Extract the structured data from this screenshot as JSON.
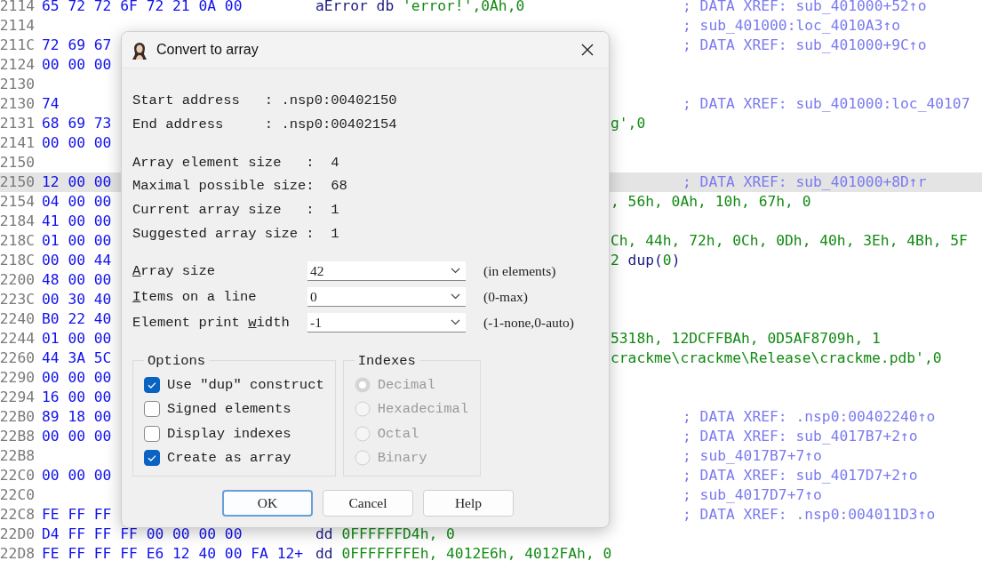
{
  "listing": {
    "rows": [
      {
        "address": "2114",
        "bytes": "65 72 72 6F 72 21 0A 00",
        "code": [
          {
            "text": "aError db ",
            "kind": "name"
          },
          {
            "text": "'error!',0Ah,0",
            "kind": "value"
          }
        ],
        "comment": "; DATA XREF: sub_401000+52↑o",
        "selected": false
      },
      {
        "address": "2114",
        "comment": "; sub_401000:loc_4010A3↑o",
        "selected": false
      },
      {
        "address": "211C",
        "bytes": "72 69 67",
        "comment": "; DATA XREF: sub_401000+9C↑o",
        "selected": false
      },
      {
        "address": "2124",
        "bytes": "00 00 00",
        "selected": false
      },
      {
        "address": "2130",
        "selected": false
      },
      {
        "address": "2130",
        "bytes": "74",
        "comment": "; DATA XREF: sub_401000:loc_40107",
        "selected": false
      },
      {
        "address": "2131",
        "bytes": "68 69 73",
        "tail": [
          {
            "text": "g',0",
            "kind": "value"
          }
        ],
        "selected": false
      },
      {
        "address": "2141",
        "bytes": "00 00 00",
        "selected": false
      },
      {
        "address": "2150",
        "selected": false
      },
      {
        "address": "2150",
        "bytes": "12 00 00",
        "comment": "; DATA XREF: sub_401000+8D↑r",
        "selected": true
      },
      {
        "address": "2154",
        "bytes": "04 00 00",
        "tail": [
          {
            "text": ", 56h, 0Ah, 10h, 67h, 0",
            "kind": "value"
          }
        ],
        "selected": false
      },
      {
        "address": "2184",
        "bytes": "41 00 00",
        "selected": false
      },
      {
        "address": "218C",
        "bytes": "01 00 00",
        "tail": [
          {
            "text": "Ch, 44h, 72h, 0Ch, 0Dh, 40h, 3Eh, 4Bh, 5F",
            "kind": "value"
          }
        ],
        "selected": false
      },
      {
        "address": "218C",
        "bytes": "00 00 44",
        "tail": [
          {
            "text": "2 ",
            "kind": "value"
          },
          {
            "text": "dup(",
            "kind": "name"
          },
          {
            "text": "0",
            "kind": "value"
          },
          {
            "text": ")",
            "kind": "name"
          }
        ],
        "selected": false
      },
      {
        "address": "2200",
        "bytes": "48 00 00",
        "selected": false
      },
      {
        "address": "223C",
        "bytes": "00 30 40",
        "selected": false
      },
      {
        "address": "2240",
        "bytes": "B0 22 40",
        "selected": false
      },
      {
        "address": "2244",
        "bytes": "01 00 00",
        "tail": [
          {
            "text": "5318h, 12DCFFBAh, 0D5AF8709h, 1",
            "kind": "value"
          }
        ],
        "selected": false
      },
      {
        "address": "2260",
        "bytes": "44 3A 5C",
        "tail": [
          {
            "text": "crackme\\crackme\\Release\\crackme.pdb',0",
            "kind": "value"
          }
        ],
        "selected": false
      },
      {
        "address": "2290",
        "bytes": "00 00 00",
        "selected": false
      },
      {
        "address": "2294",
        "bytes": "16 00 00",
        "selected": false
      },
      {
        "address": "22B0",
        "bytes": "89 18 00",
        "comment": "; DATA XREF: .nsp0:00402240↑o",
        "selected": false
      },
      {
        "address": "22B8",
        "bytes": "00 00 00",
        "comment": "; DATA XREF: sub_4017B7+2↑o",
        "selected": false
      },
      {
        "address": "22B8",
        "comment": "; sub_4017B7+7↑o",
        "selected": false
      },
      {
        "address": "22C0",
        "bytes": "00 00 00",
        "comment": "; DATA XREF: sub_4017D7+2↑o",
        "selected": false
      },
      {
        "address": "22C0",
        "comment": "; sub_4017D7+7↑o",
        "selected": false
      },
      {
        "address": "22C8",
        "bytes": "FE FF FF",
        "comment": "; DATA XREF: .nsp0:004011D3↑o",
        "selected": false
      },
      {
        "address": "22D0",
        "bytes": "D4 FF FF FF 00 00 00 00",
        "code": [
          {
            "text": "dd ",
            "kind": "name"
          },
          {
            "text": "0FFFFFFD4h, 0",
            "kind": "value"
          }
        ],
        "selected": false
      },
      {
        "address": "22D8",
        "bytes": "FE FF FF FF E6 12 40 00 FA 12+",
        "code": [
          {
            "text": "dd ",
            "kind": "name"
          },
          {
            "text": "0FFFFFFFEh, 4012E6h, 4012FAh, 0",
            "kind": "value"
          }
        ],
        "selected": false
      }
    ]
  },
  "dialog": {
    "title": "Convert to array",
    "info": [
      [
        "Start address   : .nsp0:00402150",
        "End address     : .nsp0:00402154"
      ],
      [
        "Array element size   :  4",
        "Maximal possible size:  68",
        "Current array size   :  1",
        "Suggested array size :  1"
      ]
    ],
    "fields": [
      {
        "label": [
          {
            "text": "A",
            "underlined": true
          },
          {
            "text": "rray size",
            "underlined": false
          }
        ],
        "value": "42",
        "hint": "(in elements)"
      },
      {
        "label": [
          {
            "text": "I",
            "underlined": true
          },
          {
            "text": "tems on a line",
            "underlined": false
          }
        ],
        "value": "0",
        "hint": "(0-max)"
      },
      {
        "label": [
          {
            "text": "Element print ",
            "underlined": false
          },
          {
            "text": "w",
            "underlined": true
          },
          {
            "text": "idth",
            "underlined": false
          }
        ],
        "value": "-1",
        "hint": "(-1-none,0-auto)"
      }
    ],
    "options": {
      "title": "Options",
      "items": [
        {
          "label": "Use \"dup\" construct",
          "checked": true
        },
        {
          "label": "Signed elements",
          "checked": false
        },
        {
          "label": "Display indexes",
          "checked": false
        },
        {
          "label": "Create as array",
          "checked": true
        }
      ]
    },
    "indexes": {
      "title": "Indexes",
      "items": [
        {
          "label": "Decimal",
          "selected": true,
          "disabled": true
        },
        {
          "label": "Hexadecimal",
          "selected": false,
          "disabled": true
        },
        {
          "label": "Octal",
          "selected": false,
          "disabled": true
        },
        {
          "label": "Binary",
          "selected": false,
          "disabled": true
        }
      ]
    },
    "buttons": [
      {
        "label": "OK",
        "default": true
      },
      {
        "label": "Cancel",
        "default": false
      },
      {
        "label": "Help",
        "default": false
      }
    ]
  }
}
